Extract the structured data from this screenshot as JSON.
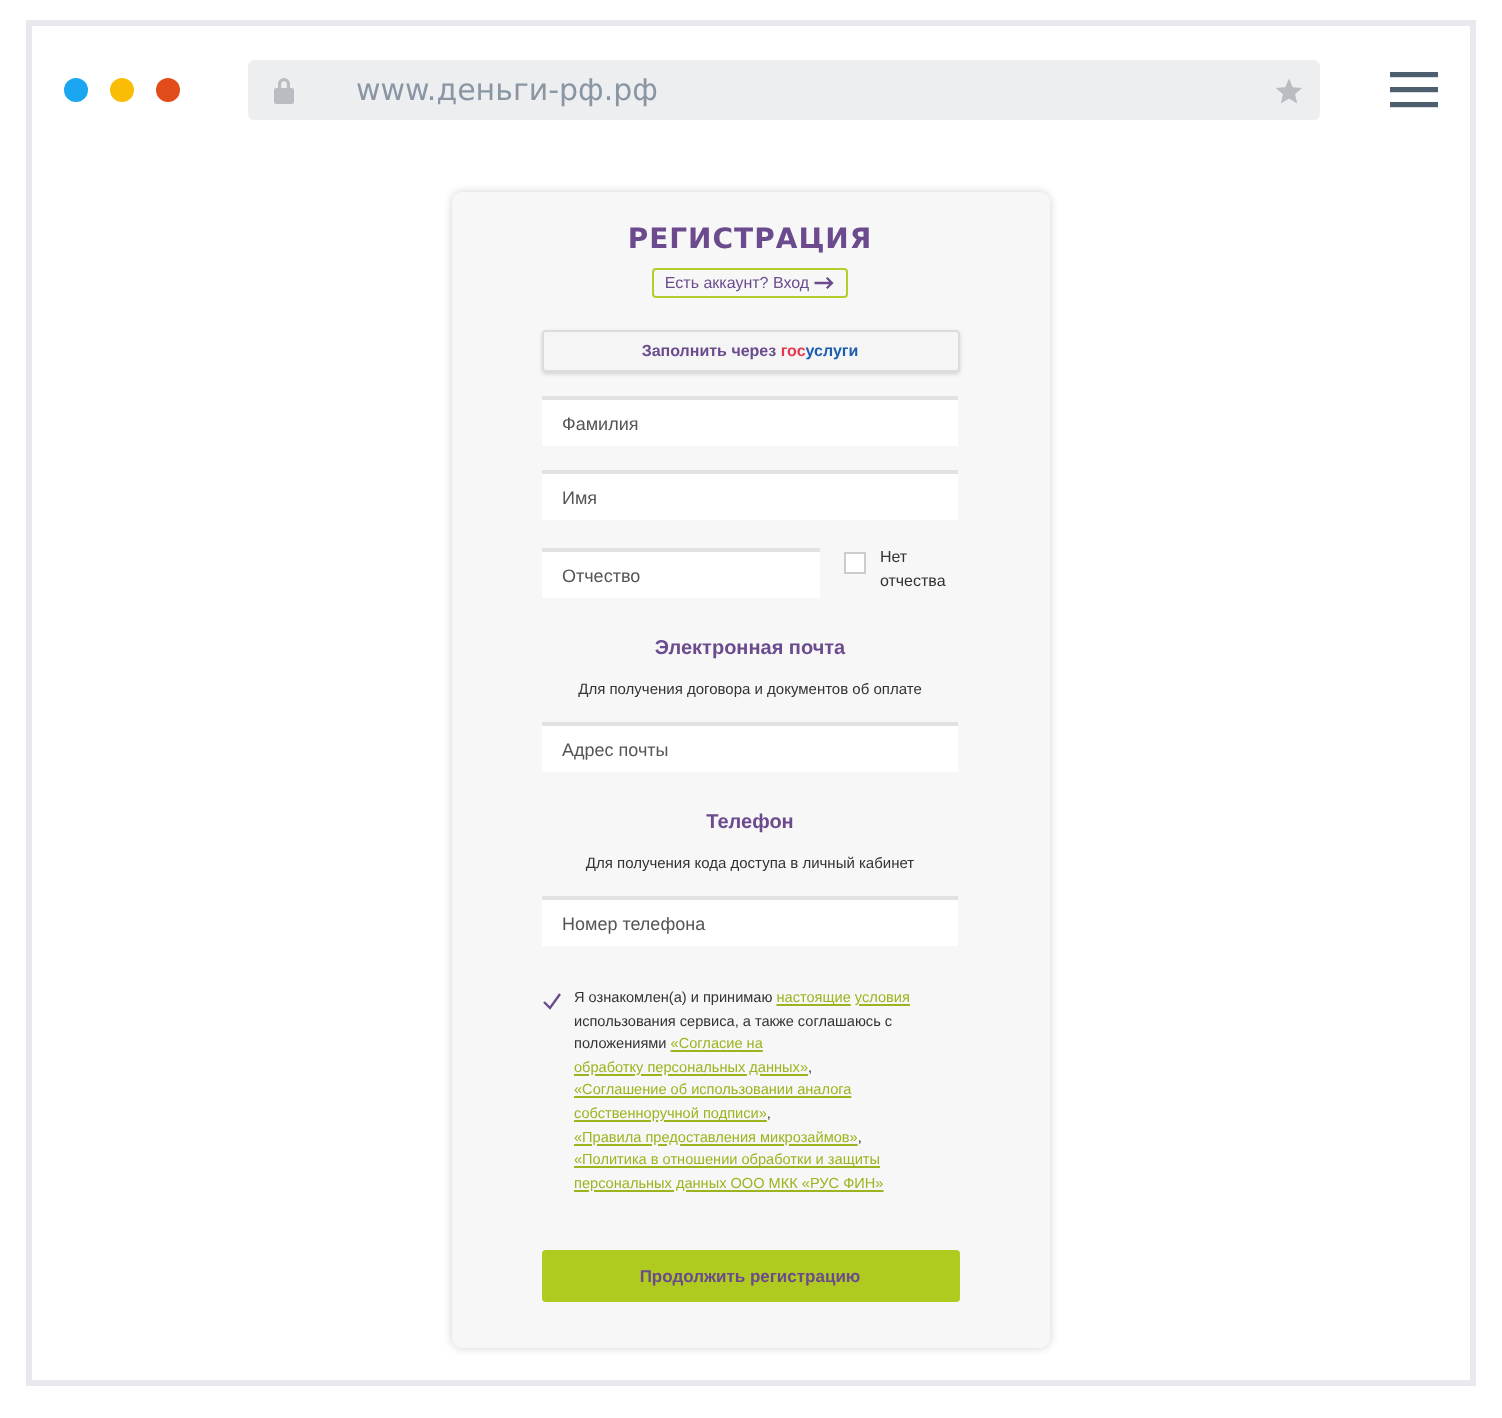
{
  "browser": {
    "dots": [
      {
        "color": "#1aa6f0"
      },
      {
        "color": "#fbbc05"
      },
      {
        "color": "#e24c1b"
      }
    ],
    "url": "www.деньги-рф.рф"
  },
  "form": {
    "title": "РЕГИСТРАЦИЯ",
    "login_link": "Есть аккаунт? Вход",
    "gosuslugi": {
      "text": "Заполнить через ",
      "brand_red": "гос",
      "brand_blue": "услуги"
    },
    "fields": [
      {
        "placeholder": "Фамилия"
      },
      {
        "placeholder": "Имя"
      }
    ],
    "patronymic": {
      "placeholder": "Отчество",
      "no_patronymic": {
        "label": "Нет отчества",
        "checked": false
      }
    },
    "email": {
      "heading": "Электронная почта",
      "hint": "Для получения договора и документов об оплате",
      "placeholder": "Адрес почты"
    },
    "phone": {
      "heading": "Телефон",
      "hint": "Для получения кода доступа в личный кабинет",
      "placeholder": "Номер телефона"
    },
    "consent": {
      "checked": true,
      "segments": [
        {
          "text": "Я ознакомлен(а) и принимаю",
          "link": false
        },
        {
          "text": "настоящие",
          "link": true
        },
        {
          "text": "условия",
          "link": true
        },
        {
          "text": "использования сервиса, а также соглашаюсь с положениями",
          "link": false
        },
        {
          "text": "«Согласие на",
          "link": true
        },
        {
          "text": "обработку персональных данных»",
          "link": true
        },
        {
          "text": ",",
          "link": false
        },
        {
          "text": "«Соглашение об использовании аналога",
          "link": true
        },
        {
          "text": "собственноручной подписи»",
          "link": true
        },
        {
          "text": ",",
          "link": false
        },
        {
          "text": "«Правила предоставления микрозаймов»",
          "link": true
        },
        {
          "text": ",",
          "link": false
        },
        {
          "text": "«Политика в отношении обработки и защиты",
          "link": true
        },
        {
          "text": "персональных данных ООО МКК «РУС ФИН»",
          "link": true
        }
      ]
    },
    "submit": "Продолжить регистрацию"
  }
}
